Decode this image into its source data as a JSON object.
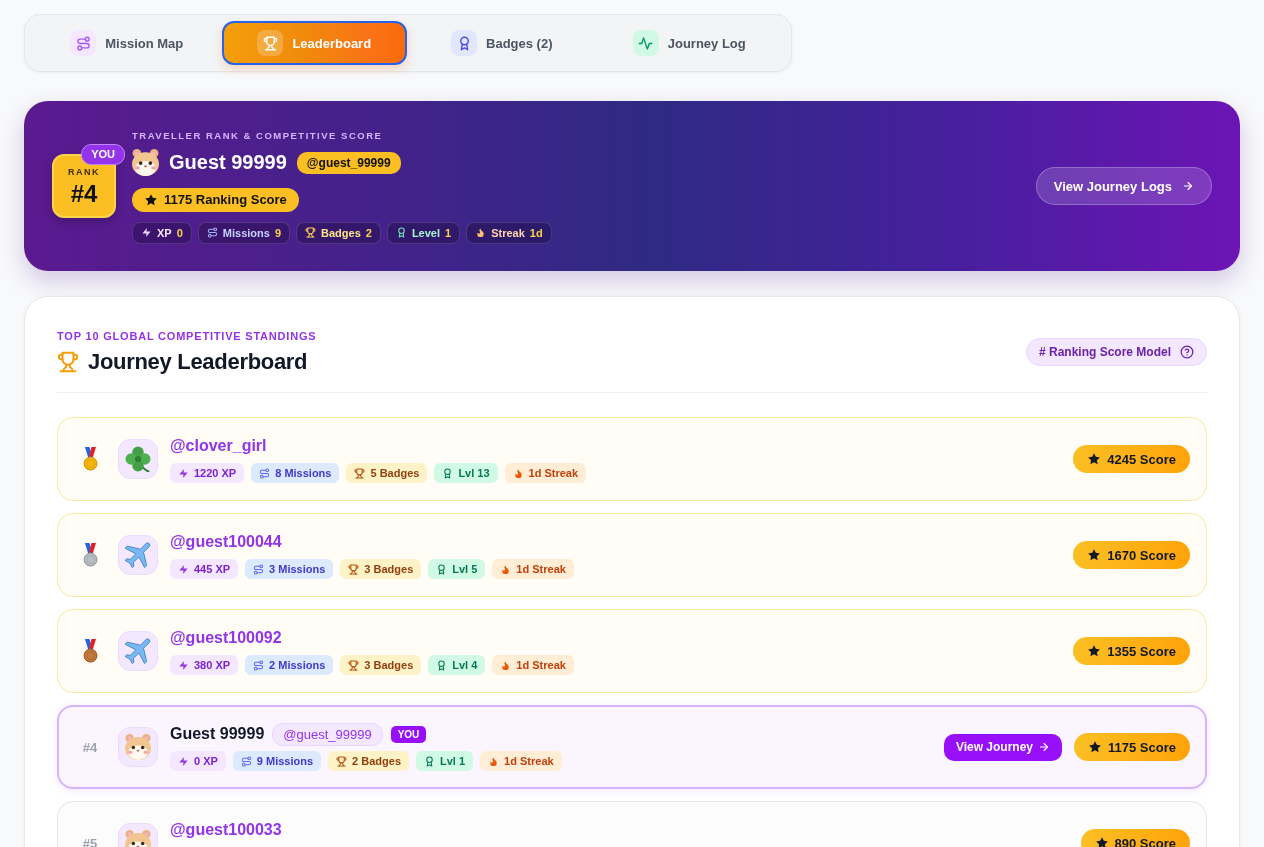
{
  "tabs": [
    {
      "kind": "map",
      "label": "Mission Map",
      "selected": false
    },
    {
      "kind": "leaderboard",
      "label": "Leaderboard",
      "selected": true
    },
    {
      "kind": "badges",
      "label": "Badges (2)",
      "selected": false
    },
    {
      "kind": "log",
      "label": "Journey Log",
      "selected": false
    }
  ],
  "hero": {
    "eyebrow": "TRAVELLER RANK & COMPETITIVE SCORE",
    "rank_label": "RANK",
    "rank": "#4",
    "you_tag": "YOU",
    "avatar": {
      "kind": "hamster"
    },
    "name": "Guest 99999",
    "handle": "@guest_99999",
    "score": "1175 Ranking Score",
    "stats": [
      {
        "kind": "xp",
        "label": "XP",
        "value": "0"
      },
      {
        "kind": "missions",
        "label": "Missions",
        "value": "9"
      },
      {
        "kind": "badges",
        "label": "Badges",
        "value": "2"
      },
      {
        "kind": "level",
        "label": "Level",
        "value": "1"
      },
      {
        "kind": "streak",
        "label": "Streak",
        "value": "1d"
      }
    ],
    "button": "View Journey Logs"
  },
  "leaderboard": {
    "eyebrow": "TOP 10 GLOBAL COMPETITIVE STANDINGS",
    "title": "Journey Leaderboard",
    "model_button": "# Ranking Score Model",
    "rows": [
      {
        "medal": {
          "kind": "gold"
        },
        "avatar": {
          "kind": "clover"
        },
        "name": "@clover_girl",
        "current": false,
        "stats": [
          {
            "kind": "xp",
            "text": "1220 XP"
          },
          {
            "kind": "missions",
            "text": "8 Missions"
          },
          {
            "kind": "badges",
            "text": "5 Badges"
          },
          {
            "kind": "level",
            "text": "Lvl 13"
          },
          {
            "kind": "streak",
            "text": "1d Streak"
          }
        ],
        "score": "4245 Score"
      },
      {
        "medal": {
          "kind": "silver"
        },
        "avatar": {
          "kind": "plane"
        },
        "name": "@guest100044",
        "current": false,
        "stats": [
          {
            "kind": "xp",
            "text": "445 XP"
          },
          {
            "kind": "missions",
            "text": "3 Missions"
          },
          {
            "kind": "badges",
            "text": "3 Badges"
          },
          {
            "kind": "level",
            "text": "Lvl 5"
          },
          {
            "kind": "streak",
            "text": "1d Streak"
          }
        ],
        "score": "1670 Score"
      },
      {
        "medal": {
          "kind": "bronze"
        },
        "avatar": {
          "kind": "plane"
        },
        "name": "@guest100092",
        "current": false,
        "stats": [
          {
            "kind": "xp",
            "text": "380 XP"
          },
          {
            "kind": "missions",
            "text": "2 Missions"
          },
          {
            "kind": "badges",
            "text": "3 Badges"
          },
          {
            "kind": "level",
            "text": "Lvl 4"
          },
          {
            "kind": "streak",
            "text": "1d Streak"
          }
        ],
        "score": "1355 Score"
      },
      {
        "rank": "#4",
        "avatar": {
          "kind": "hamster"
        },
        "name": "Guest 99999",
        "handle": "@guest_99999",
        "you_tag": "YOU",
        "current": true,
        "stats": [
          {
            "kind": "xp",
            "text": "0 XP"
          },
          {
            "kind": "missions",
            "text": "9 Missions"
          },
          {
            "kind": "badges",
            "text": "2 Badges"
          },
          {
            "kind": "level",
            "text": "Lvl 1"
          },
          {
            "kind": "streak",
            "text": "1d Streak"
          }
        ],
        "action": "View Journey",
        "score": "1175 Score"
      },
      {
        "rank": "#5",
        "avatar": {
          "kind": "hamster"
        },
        "name": "@guest100033",
        "current": false,
        "score": "890 Score"
      }
    ]
  }
}
